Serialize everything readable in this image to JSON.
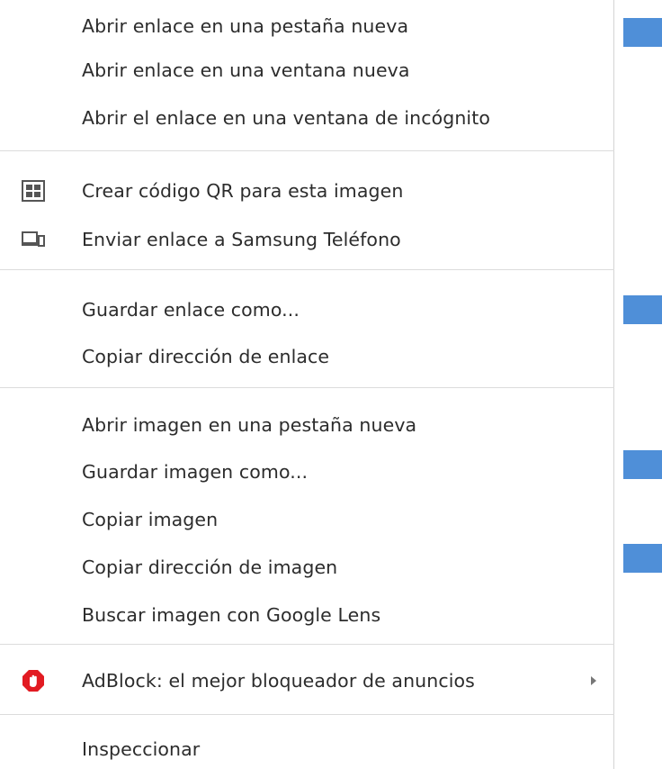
{
  "menu": {
    "groups": [
      {
        "items": [
          {
            "label": "Abrir enlace en una pestaña nueva"
          },
          {
            "label": "Abrir enlace en una ventana nueva"
          },
          {
            "label": "Abrir el enlace en una ventana de incógnito"
          }
        ]
      },
      {
        "items": [
          {
            "label": "Crear código QR para esta imagen",
            "icon": "qr-code-icon"
          },
          {
            "label": "Enviar enlace a Samsung Teléfono",
            "icon": "send-to-device-icon"
          }
        ]
      },
      {
        "items": [
          {
            "label": "Guardar enlace como..."
          },
          {
            "label": "Copiar dirección de enlace"
          }
        ]
      },
      {
        "items": [
          {
            "label": "Abrir imagen en una pestaña nueva"
          },
          {
            "label": "Guardar imagen como..."
          },
          {
            "label": "Copiar imagen"
          },
          {
            "label": "Copiar dirección de imagen"
          },
          {
            "label": "Buscar imagen con Google Lens"
          }
        ]
      },
      {
        "items": [
          {
            "label": "AdBlock: el mejor bloqueador de anuncios",
            "icon": "adblock-hand-icon",
            "submenu": true
          }
        ]
      },
      {
        "items": [
          {
            "label": "Inspeccionar"
          }
        ]
      }
    ]
  },
  "colors": {
    "menu_background": "#ffffff",
    "text": "#2c2c2c",
    "separator": "#dcdcdc",
    "adblock_red": "#e21b22",
    "page_accent_blue": "#4f8fd8"
  }
}
